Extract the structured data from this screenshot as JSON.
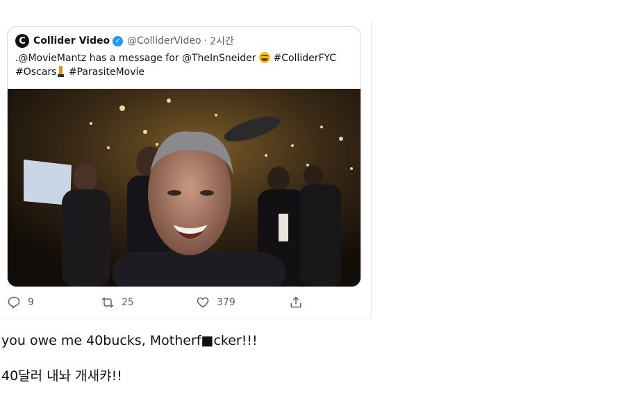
{
  "tweet": {
    "avatar_letter": "C",
    "display_name": "Collider Video",
    "handle": "@ColliderVideo",
    "separator": "·",
    "time": "2시간",
    "text_line1": ".@MovieMantz has a message for @TheInSneider",
    "text_line1_tag": "#ColliderFYC",
    "text_line2_tag1": "#Oscars",
    "text_line2_tag2": "#ParasiteMovie",
    "emoji_icon": "face-with-tears-of-joy",
    "oscar_icon": "oscar-statue",
    "actions": {
      "reply_count": "9",
      "retweet_count": "25",
      "like_count": "379"
    },
    "colors": {
      "accent": "#1d9bf0",
      "muted": "#536471",
      "border": "#cfd9de"
    }
  },
  "captions": {
    "line1": "you owe me 40bucks, Motherf■cker!!!",
    "line2": "40달러 내놔 개새캬!!"
  }
}
